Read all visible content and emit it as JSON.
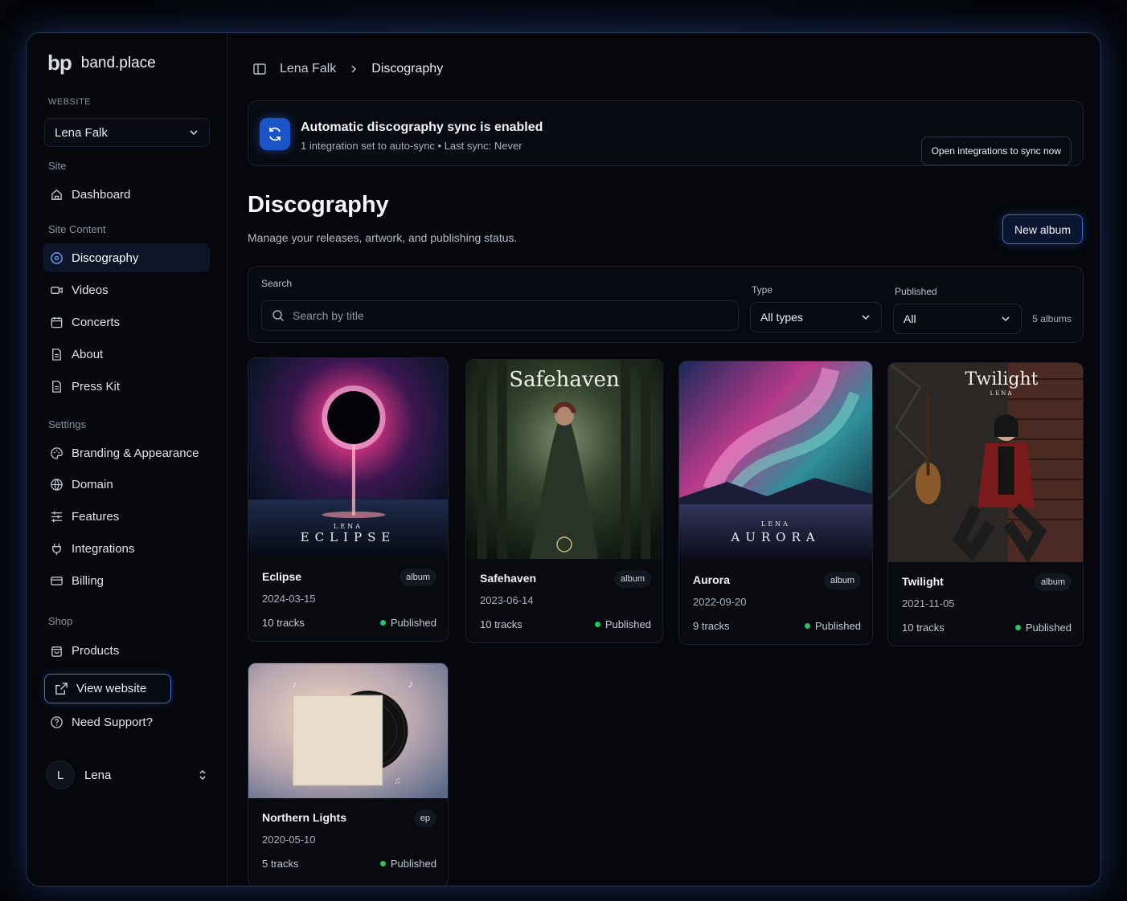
{
  "brand": {
    "logo": "bp",
    "name": "band.place"
  },
  "sidebar": {
    "website_label": "WEBSITE",
    "website_value": "Lena Falk",
    "site_label": "Site",
    "site_content_label": "Site Content",
    "settings_label": "Settings",
    "shop_label": "Shop",
    "items": {
      "dashboard": "Dashboard",
      "discography": "Discography",
      "videos": "Videos",
      "concerts": "Concerts",
      "about": "About",
      "press_kit": "Press Kit",
      "branding": "Branding & Appearance",
      "domain": "Domain",
      "features": "Features",
      "integrations": "Integrations",
      "billing": "Billing",
      "products": "Products"
    },
    "view_website": "View website",
    "support": "Need Support?",
    "user": {
      "initial": "L",
      "name": "Lena"
    }
  },
  "breadcrumb": {
    "parent": "Lena Falk",
    "current": "Discography"
  },
  "sync": {
    "title": "Automatic discography sync is enabled",
    "subtitle": "1 integration set to auto-sync • Last sync: Never",
    "button": "Open integrations to sync now"
  },
  "page": {
    "title": "Discography",
    "subtitle": "Manage your releases, artwork, and publishing status.",
    "new_button": "New album"
  },
  "filters": {
    "search_label": "Search",
    "search_placeholder": "Search by title",
    "type_label": "Type",
    "type_value": "All types",
    "published_label": "Published",
    "published_value": "All",
    "count": "5 albums"
  },
  "albums": [
    {
      "title": "Eclipse",
      "type": "album",
      "date": "2024-03-15",
      "tracks": "10 tracks",
      "status": "Published",
      "art_text": "ECLIPSE",
      "art_small": "LENA"
    },
    {
      "title": "Safehaven",
      "type": "album",
      "date": "2023-06-14",
      "tracks": "10 tracks",
      "status": "Published",
      "art_text": "Safehaven"
    },
    {
      "title": "Aurora",
      "type": "album",
      "date": "2022-09-20",
      "tracks": "9 tracks",
      "status": "Published",
      "art_text": "AURORA",
      "art_small": "LENA"
    },
    {
      "title": "Twilight",
      "type": "album",
      "date": "2021-11-05",
      "tracks": "10 tracks",
      "status": "Published",
      "art_text": "Twilight",
      "art_small": "LENA"
    },
    {
      "title": "Northern Lights",
      "type": "ep",
      "date": "2020-05-10",
      "tracks": "5 tracks",
      "status": "Published"
    }
  ],
  "colors": {
    "accent": "#3a6bd0",
    "published": "#22c55e"
  }
}
